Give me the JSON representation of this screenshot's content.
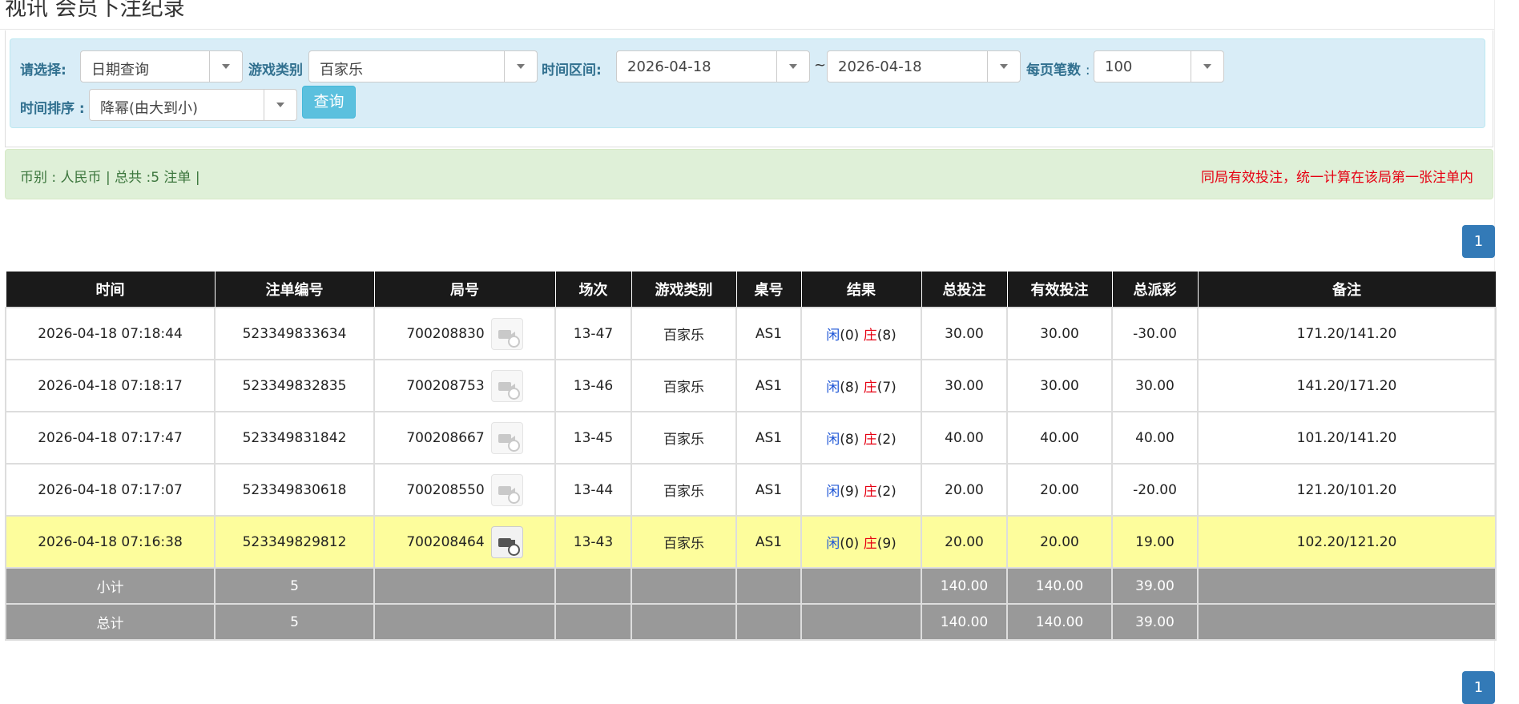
{
  "page": {
    "title": "视讯 会员下注纪录"
  },
  "filters": {
    "select_label": "请选择:",
    "select_value": "日期查询",
    "game_type_label": "游戏类别",
    "game_type_value": "百家乐",
    "time_range_label": "时间区间:",
    "start_date": "2026-04-18",
    "tilde": "~",
    "end_date": "2026-04-18",
    "page_size_label": "每页笔数",
    "page_size_colon": ":",
    "page_size_value": "100",
    "sort_label": "时间排序 :",
    "sort_value": "降幂(由大到小)",
    "query_button": "查询"
  },
  "info": {
    "summary": "币别 : 人民币 | 总共 :5 注单 |",
    "notice": "同局有效投注，统一计算在该局第一张注单内"
  },
  "pagination": {
    "current_page": "1"
  },
  "table": {
    "headers": [
      "时间",
      "注单编号",
      "局号",
      "场次",
      "游戏类别",
      "桌号",
      "结果",
      "总投注",
      "有效投注",
      "总派彩",
      "备注"
    ],
    "rows": [
      {
        "time": "2026-04-18 07:18:44",
        "bet_id": "523349833634",
        "round": "700208830",
        "session": "13-47",
        "game": "百家乐",
        "table": "AS1",
        "player_label": "闲",
        "player_score": "(0)",
        "banker_label": "庄",
        "banker_score": "(8)",
        "total_bet": "30.00",
        "valid_bet": "30.00",
        "payout": "-30.00",
        "payout_negative": true,
        "note": "171.20/141.20",
        "highlighted": false
      },
      {
        "time": "2026-04-18 07:18:17",
        "bet_id": "523349832835",
        "round": "700208753",
        "session": "13-46",
        "game": "百家乐",
        "table": "AS1",
        "player_label": "闲",
        "player_score": "(8)",
        "banker_label": "庄",
        "banker_score": "(7)",
        "total_bet": "30.00",
        "valid_bet": "30.00",
        "payout": "30.00",
        "payout_negative": false,
        "note": "141.20/171.20",
        "highlighted": false
      },
      {
        "time": "2026-04-18 07:17:47",
        "bet_id": "523349831842",
        "round": "700208667",
        "session": "13-45",
        "game": "百家乐",
        "table": "AS1",
        "player_label": "闲",
        "player_score": "(8)",
        "banker_label": "庄",
        "banker_score": "(2)",
        "total_bet": "40.00",
        "valid_bet": "40.00",
        "payout": "40.00",
        "payout_negative": false,
        "note": "101.20/141.20",
        "highlighted": false
      },
      {
        "time": "2026-04-18 07:17:07",
        "bet_id": "523349830618",
        "round": "700208550",
        "session": "13-44",
        "game": "百家乐",
        "table": "AS1",
        "player_label": "闲",
        "player_score": "(9)",
        "banker_label": "庄",
        "banker_score": "(2)",
        "total_bet": "20.00",
        "valid_bet": "20.00",
        "payout": "-20.00",
        "payout_negative": true,
        "note": "121.20/101.20",
        "highlighted": false
      },
      {
        "time": "2026-04-18 07:16:38",
        "bet_id": "523349829812",
        "round": "700208464",
        "session": "13-43",
        "game": "百家乐",
        "table": "AS1",
        "player_label": "闲",
        "player_score": "(0)",
        "banker_label": "庄",
        "banker_score": "(9)",
        "total_bet": "20.00",
        "valid_bet": "20.00",
        "payout": "19.00",
        "payout_negative": false,
        "note": "102.20/121.20",
        "highlighted": true
      }
    ],
    "subtotal": {
      "label": "小计",
      "count": "5",
      "total_bet": "140.00",
      "valid_bet": "140.00",
      "payout": "39.00"
    },
    "grand_total": {
      "label": "总计",
      "count": "5",
      "total_bet": "140.00",
      "valid_bet": "140.00",
      "payout": "39.00"
    }
  },
  "colors": {
    "filter_bg": "#d9edf7",
    "info_bg": "#dff0d8",
    "header_bg": "#1a1a1a",
    "highlight_row": "#fdfd9c",
    "summary_row": "#999999",
    "positive_blue": "#1e56d6",
    "negative_red": "#e60012",
    "primary": "#337ab7",
    "query_button": "#5bc0de"
  },
  "icons": {
    "replay": "video-replay-icon",
    "dropdown": "chevron-down-icon"
  }
}
